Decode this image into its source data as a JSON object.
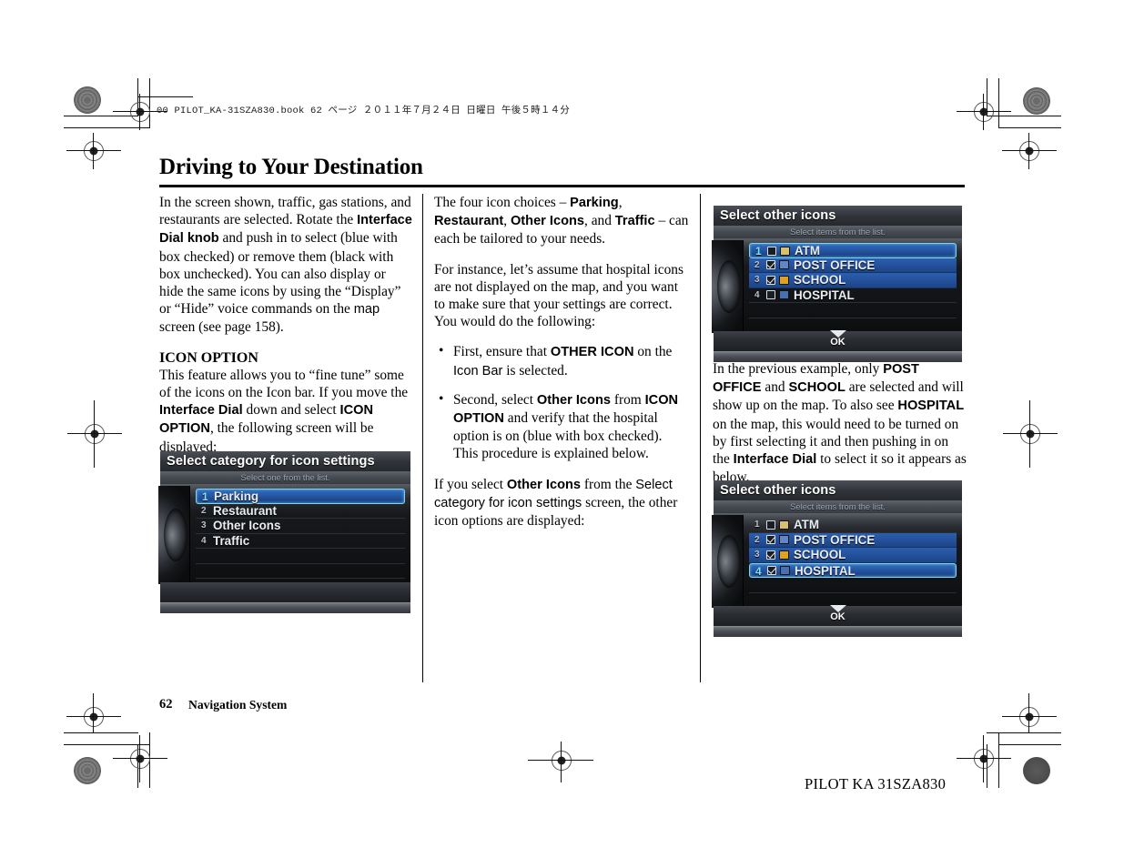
{
  "document": {
    "file_header": "00 PILOT_KA-31SZA830.book   62 ページ   ２０１１年７月２４日   日曜日   午後５時１４分",
    "title": "Driving to Your Destination",
    "footer_page_number": "62",
    "footer_section": "Navigation System",
    "footer_code": "PILOT KA  31SZA830"
  },
  "column1": {
    "para1_a": "In the screen shown, traffic, gas stations, and restaurants are selected. Rotate the ",
    "para1_b": "Interface Dial knob",
    "para1_c": " and push in to select (blue with box checked) or remove them (black with box unchecked). You can also display or hide the same icons by using the “Display” or “Hide” voice commands on the ",
    "para1_d": "map",
    "para1_e": " screen (see page 158).",
    "heading": "ICON OPTION",
    "para2_a": "This feature allows you to “fine tune” some of the icons on the Icon bar. If you move the ",
    "para2_b": "Interface Dial",
    "para2_c": " down and select ",
    "para2_d": "ICON OPTION",
    "para2_e": ", the following screen will be displayed:"
  },
  "column2": {
    "para1_a": "The four icon choices – ",
    "para1_b": "Parking",
    "para1_c": ", ",
    "para1_d": "Restaurant",
    "para1_e": ", ",
    "para1_f": "Other Icons",
    "para1_g": ", and ",
    "para1_h": "Traffic",
    "para1_i": " – can each be tailored to your needs.",
    "para2": "For instance, let’s assume that hospital icons are not displayed on the map, and you want to make sure that your settings are correct. You would do the following:",
    "bullet1_a": "First, ensure that ",
    "bullet1_b": "OTHER ICON",
    "bullet1_c": " on the ",
    "bullet1_d": "Icon Bar",
    "bullet1_e": " is selected.",
    "bullet2_a": "Second, select ",
    "bullet2_b": "Other Icons",
    "bullet2_c": " from ",
    "bullet2_d": "ICON OPTION",
    "bullet2_e": " and verify that the hospital option is on (blue with box checked). This procedure is explained below.",
    "para3_a": "If you select ",
    "para3_b": "Other Icons",
    "para3_c": " from the ",
    "para3_d": "Select category for icon settings",
    "para3_e": " screen, the other icon options are displayed:"
  },
  "column3": {
    "para1_a": "In the previous example, only ",
    "para1_b": "POST OFFICE",
    "para1_c": " and ",
    "para1_d": "SCHOOL",
    "para1_e": " are selected and will show up on the map. To also see ",
    "para1_f": "HOSPITAL",
    "para1_g": " on the map, this would need to be turned on by first selecting it and then pushing in on the ",
    "para1_h": "Interface Dial",
    "para1_i": " to select it so it appears as below."
  },
  "nav_screen_1": {
    "title": "Select category for icon settings",
    "subtitle": "Select one from the list.",
    "has_ok_button": false,
    "rows": [
      {
        "number": "1",
        "label": "Parking",
        "selected": true,
        "checkbox": false,
        "checked": false,
        "icon": null
      },
      {
        "number": "2",
        "label": "Restaurant",
        "selected": false,
        "checkbox": false,
        "checked": false,
        "icon": null
      },
      {
        "number": "3",
        "label": "Other Icons",
        "selected": false,
        "checkbox": false,
        "checked": false,
        "icon": null
      },
      {
        "number": "4",
        "label": "Traffic",
        "selected": false,
        "checkbox": false,
        "checked": false,
        "icon": null
      }
    ],
    "blank_rows": 3
  },
  "nav_screen_2": {
    "title": "Select other icons",
    "subtitle": "Select items from the list.",
    "has_ok_button": true,
    "ok_label": "OK",
    "rows": [
      {
        "number": "1",
        "label": "ATM",
        "selected": true,
        "highlighted": false,
        "checkbox": true,
        "checked": false,
        "icon": "atm-icon",
        "icon_color": "#d8c070"
      },
      {
        "number": "2",
        "label": "POST OFFICE",
        "selected": false,
        "highlighted": true,
        "checkbox": true,
        "checked": true,
        "icon": "post-office-icon",
        "icon_color": "#5e86c8"
      },
      {
        "number": "3",
        "label": "SCHOOL",
        "selected": false,
        "highlighted": true,
        "checkbox": true,
        "checked": true,
        "icon": "school-icon",
        "icon_color": "#e0a020"
      },
      {
        "number": "4",
        "label": "HOSPITAL",
        "selected": false,
        "highlighted": false,
        "checkbox": true,
        "checked": false,
        "icon": "hospital-icon",
        "icon_color": "#4a6fb0"
      }
    ],
    "blank_rows": 3
  },
  "nav_screen_3": {
    "title": "Select other icons",
    "subtitle": "Select items from the list.",
    "has_ok_button": true,
    "ok_label": "OK",
    "rows": [
      {
        "number": "1",
        "label": "ATM",
        "selected": false,
        "highlighted": false,
        "checkbox": true,
        "checked": false,
        "icon": "atm-icon",
        "icon_color": "#d8c070"
      },
      {
        "number": "2",
        "label": "POST OFFICE",
        "selected": false,
        "highlighted": true,
        "checkbox": true,
        "checked": true,
        "icon": "post-office-icon",
        "icon_color": "#5e86c8"
      },
      {
        "number": "3",
        "label": "SCHOOL",
        "selected": false,
        "highlighted": true,
        "checkbox": true,
        "checked": true,
        "icon": "school-icon",
        "icon_color": "#e0a020"
      },
      {
        "number": "4",
        "label": "HOSPITAL",
        "selected": true,
        "highlighted": true,
        "checkbox": true,
        "checked": true,
        "icon": "hospital-icon",
        "icon_color": "#4a6fb0"
      }
    ],
    "blank_rows": 3
  },
  "colors": {
    "selection_blue": "#2a5cab",
    "selection_border": "#7fd2f2",
    "screen_bg": "#0d0e10"
  }
}
